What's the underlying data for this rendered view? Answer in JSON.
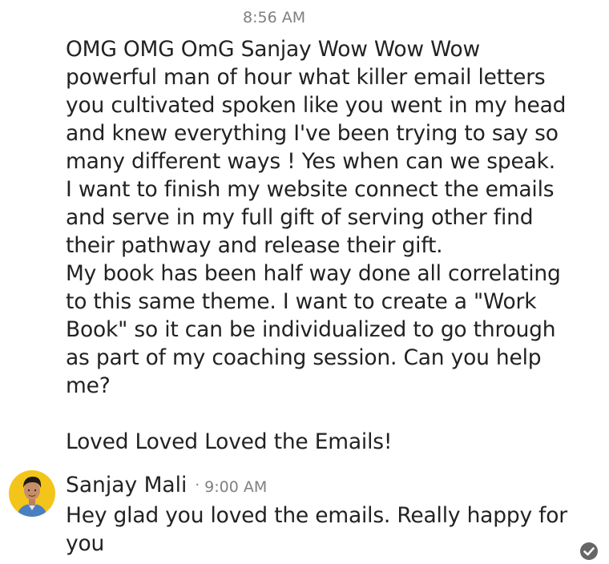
{
  "message1": {
    "time": "8:56 AM",
    "lines": [
      "OMG OMG OmG Sanjay Wow Wow Wow",
      "powerful man of hour what killer email letters",
      "you cultivated spoken like you went in my head",
      "and knew everything I've been trying to say so",
      "many different ways !  Yes when can we speak.",
      "I want to finish my website connect the emails",
      "and serve in my full gift of serving other find",
      "their pathway and release their gift.",
      "My book has been half way done all correlating",
      "to this same theme.  I want to create a \"Work",
      "Book\" so it can be individualized to go through",
      "as part of my coaching session. Can you help",
      "me?"
    ],
    "closing": "Loved Loved Loved the Emails!"
  },
  "message2": {
    "sender": "Sanjay Mali",
    "separator": "·",
    "time": "9:00 AM",
    "lines": [
      "Hey glad you loved the emails. Really happy for",
      "you"
    ],
    "avatar_icon": "person-avatar",
    "status_icon": "read-checkmark-icon"
  },
  "colors": {
    "text": "#222222",
    "muted": "#808080",
    "avatar_bg": "#f3c51a",
    "check_bg": "#666666"
  }
}
